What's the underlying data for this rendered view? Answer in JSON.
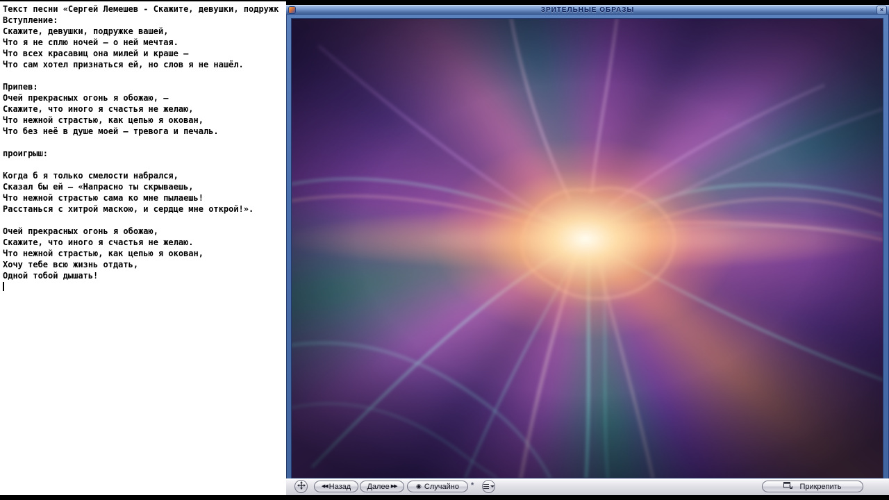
{
  "lyrics": {
    "lines": [
      "Текст песни «Сергей Лемешев - Скажите, девушки, подружк",
      "Вступление:",
      "Скажите, девушки, подружке вашей,",
      "Что я не сплю ночей – о ней мечтая.",
      "Что всех красавиц она милей и краше –",
      "Что сам хотел признаться ей, но слов я не нашёл.",
      "",
      "Припев:",
      "Очей прекрасных огонь я обожаю, –",
      "Скажите, что иного я счастья не желаю,",
      "Что нежной страстью, как цепью я окован,",
      "Что без неё в душе моей – тревога и печаль.",
      "",
      "проигрыш:",
      "",
      "Когда б я только смелости набрался,",
      "Сказал бы ей – «Напрасно ты скрываешь,",
      "Что нежной страстью сама ко мне пылаешь!",
      "Расстанься с хитрой маскою, и сердце мне открой!».",
      "",
      "Очей прекрасных огонь я обожаю,",
      "Скажите, что иного я счастья не желаю.",
      "Что нежной страстью, как цепью я окован,",
      "Хочу тебе всю жизнь отдать,",
      "Одной тобой дышать!"
    ]
  },
  "player": {
    "title_bar": {
      "title": "ЗРИТЕЛЬНЫЕ ОБРАЗЫ",
      "close_label": "×"
    },
    "controls": {
      "back_icon": "◀◀",
      "back_label": "Назад",
      "next_label": "Далее",
      "next_icon": "▶▶",
      "random_icon": "◉",
      "random_label": "Случайно",
      "sparkle_icon": "*",
      "pin_label": "Прикрепить"
    }
  },
  "colors": {
    "frame_blue": "#4a70ae",
    "title_bar_top": "#aec4e6",
    "title_bar_bottom": "#3c5c94",
    "title_text": "#0e2058",
    "control_bar": "#cdcdd6",
    "button_text": "#141420",
    "viz_core": "#ffeecb",
    "viz_purple": "#5a3484",
    "viz_teal": "#2fae92"
  }
}
